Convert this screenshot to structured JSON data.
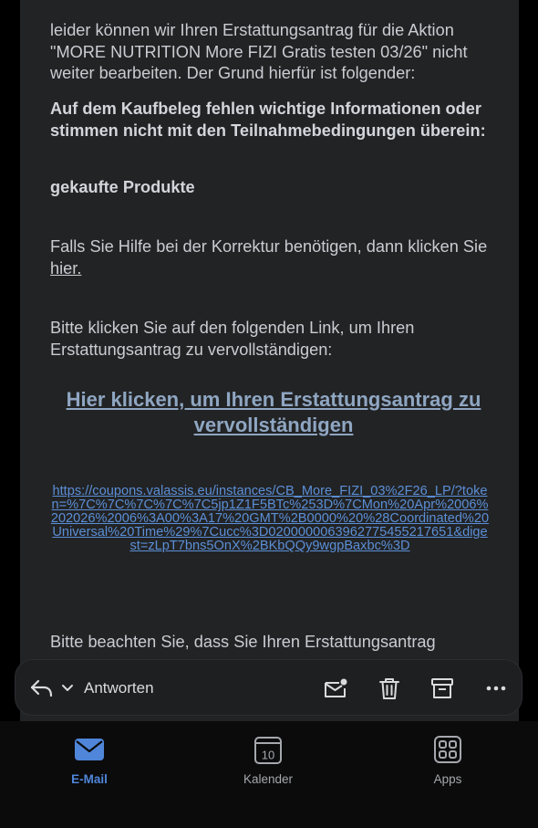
{
  "email": {
    "para1": "leider können wir Ihren Erstattungsantrag für die Aktion \"MORE NUTRITION More FIZI Gratis testen 03/26\" nicht weiter bearbeiten. Der Grund hierfür ist folgender:",
    "reason_heading": "Auf dem Kaufbeleg fehlen wichtige Informationen oder stimmen nicht mit den Teilnahmebedingungen überein:",
    "reason_item": "gekaufte Produkte",
    "help_text": "Falls Sie Hilfe bei der Korrektur benötigen, dann klicken Sie ",
    "help_link": "hier.",
    "complete_prompt": "Bitte klicken Sie auf den folgenden Link, um Ihren Erstattungsantrag zu vervollständigen:",
    "complete_link": "Hier klicken, um Ihren Erstattungsantrag zu vervollständigen",
    "url": "https://coupons.valassis.eu/instances/CB_More_FIZI_03%2F26_LP/?token=%7C%7C%7C%7C%7C5jp1Z1F5BTc%253D%7CMon%20Apr%2006%202026%2006%3A00%3A17%20GMT%2B0000%20%28Coordinated%20Universal%20Time%29%7Cucc%3D0200000063962775455217651&digest=zLpT7bns5OnX%2BKbQQy9wgpBaxbc%3D",
    "para_last": "Bitte beachten Sie, dass Sie Ihren Erstattungsantrag"
  },
  "action_bar": {
    "reply_label": "Antworten",
    "icons": [
      "reply-icon",
      "chevron-down-icon",
      "mark-unread-icon",
      "trash-icon",
      "archive-icon",
      "more-icon"
    ]
  },
  "tabbar": {
    "tabs": [
      {
        "label": "E-Mail",
        "icon": "mail-icon",
        "active": true
      },
      {
        "label": "Kalender",
        "icon": "calendar-icon",
        "badge": "10",
        "active": false
      },
      {
        "label": "Apps",
        "icon": "apps-icon",
        "active": false
      }
    ]
  },
  "colors": {
    "background": "#000000",
    "card": "#222325",
    "text": "#c9ccd1",
    "link": "#5b8fd6",
    "accent": "#4f86d9"
  }
}
